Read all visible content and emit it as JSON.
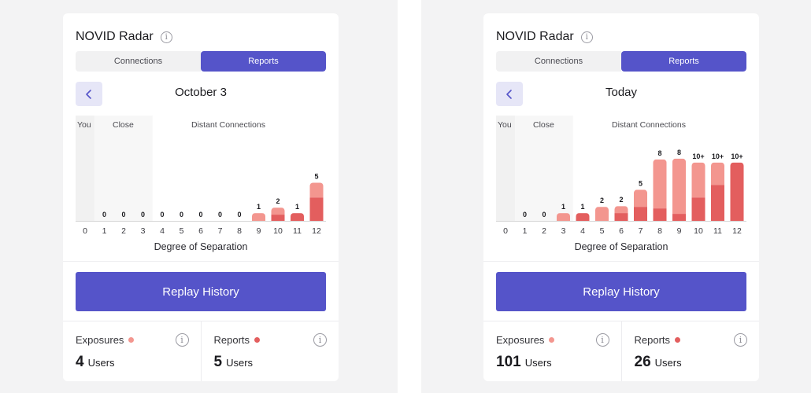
{
  "colors": {
    "accent": "#5554c9",
    "accent_light": "#e6e6f7",
    "exposure": "#f3968f",
    "report": "#e35e5e",
    "zone_shade_you": "#f1f1f1",
    "zone_shade_close": "#f7f7f7",
    "axis": "#d6d6d6"
  },
  "panels": [
    {
      "title": "NOVID Radar",
      "tabs": [
        "Connections",
        "Reports"
      ],
      "active_tab": 1,
      "date": "October 3",
      "chart_data": {
        "type": "bar",
        "stacked": true,
        "xlabel": "Degree of Separation",
        "x": [
          "0",
          "1",
          "2",
          "3",
          "4",
          "5",
          "6",
          "7",
          "8",
          "9",
          "10",
          "11",
          "12"
        ],
        "zones": [
          "You",
          "Close",
          "Distant Connections"
        ],
        "value_labels": [
          "",
          "0",
          "0",
          "0",
          "0",
          "0",
          "0",
          "0",
          "0",
          "1",
          "2",
          "1",
          "5"
        ],
        "series": [
          {
            "values": [
              0,
              0,
              0,
              0,
              0,
              0,
              0,
              0,
              0,
              0.0,
              0.8,
              1.0,
              3.0
            ]
          },
          {
            "values": [
              0,
              0,
              0,
              0,
              0,
              0,
              0,
              0,
              0,
              1.0,
              0.9,
              0.0,
              1.9
            ]
          }
        ],
        "ylim": [
          0,
          10
        ]
      },
      "replay_label": "Replay History",
      "stats": [
        {
          "label": "Exposures",
          "value": "4",
          "unit": "Users",
          "dot": "exposure"
        },
        {
          "label": "Reports",
          "value": "5",
          "unit": "Users",
          "dot": "report"
        }
      ]
    },
    {
      "title": "NOVID Radar",
      "tabs": [
        "Connections",
        "Reports"
      ],
      "active_tab": 1,
      "date": "Today",
      "chart_data": {
        "type": "bar",
        "stacked": true,
        "xlabel": "Degree of Separation",
        "x": [
          "0",
          "1",
          "2",
          "3",
          "4",
          "5",
          "6",
          "7",
          "8",
          "9",
          "10",
          "11",
          "12"
        ],
        "zones": [
          "You",
          "Close",
          "Distant Connections"
        ],
        "value_labels": [
          "",
          "0",
          "0",
          "1",
          "1",
          "2",
          "2",
          "5",
          "8",
          "8",
          "10+",
          "10+",
          "10+"
        ],
        "series": [
          {
            "values": [
              0,
              0,
              0,
              0,
              1.0,
              0.0,
              1.0,
              1.8,
              1.6,
              0.9,
              3.0,
              4.6,
              7.5
            ]
          },
          {
            "values": [
              0,
              0,
              0,
              1.0,
              0.0,
              1.8,
              0.9,
              2.2,
              6.3,
              7.1,
              4.5,
              2.9,
              0.0
            ]
          }
        ],
        "ylim": [
          0,
          10
        ]
      },
      "replay_label": "Replay History",
      "stats": [
        {
          "label": "Exposures",
          "value": "101",
          "unit": "Users",
          "dot": "exposure"
        },
        {
          "label": "Reports",
          "value": "26",
          "unit": "Users",
          "dot": "report"
        }
      ]
    }
  ]
}
